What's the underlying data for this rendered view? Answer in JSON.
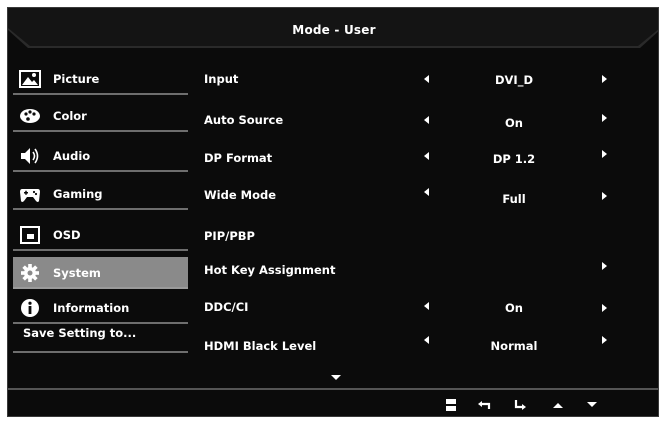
{
  "header": {
    "title": "Mode - User"
  },
  "sidebar": {
    "items": [
      {
        "label": "Picture",
        "icon": "picture-icon"
      },
      {
        "label": "Color",
        "icon": "palette-icon"
      },
      {
        "label": "Audio",
        "icon": "speaker-icon"
      },
      {
        "label": "Gaming",
        "icon": "gamepad-icon"
      },
      {
        "label": "OSD",
        "icon": "osd-icon"
      },
      {
        "label": "System",
        "icon": "gear-icon",
        "selected": true
      },
      {
        "label": "Information",
        "icon": "info-icon"
      }
    ],
    "save_label": "Save Setting to..."
  },
  "settings": [
    {
      "label": "Input",
      "value": "DVI_D"
    },
    {
      "label": "Auto Source",
      "value": "On"
    },
    {
      "label": "DP Format",
      "value": "DP 1.2"
    },
    {
      "label": "Wide Mode",
      "value": "Full"
    },
    {
      "label": "PIP/PBP",
      "value": ""
    },
    {
      "label": "Hot Key Assignment",
      "value": ""
    },
    {
      "label": "DDC/CI",
      "value": "On"
    },
    {
      "label": "HDMI Black Level",
      "value": "Normal"
    }
  ],
  "footer": {
    "keys": [
      "menu-icon",
      "back-icon",
      "enter-icon",
      "up-arrow-icon",
      "down-arrow-icon"
    ]
  },
  "colors": {
    "background": "#0b0b0b",
    "selected": "#8a8a8a",
    "text": "#ffffff",
    "divider": "#6e6e6e"
  }
}
